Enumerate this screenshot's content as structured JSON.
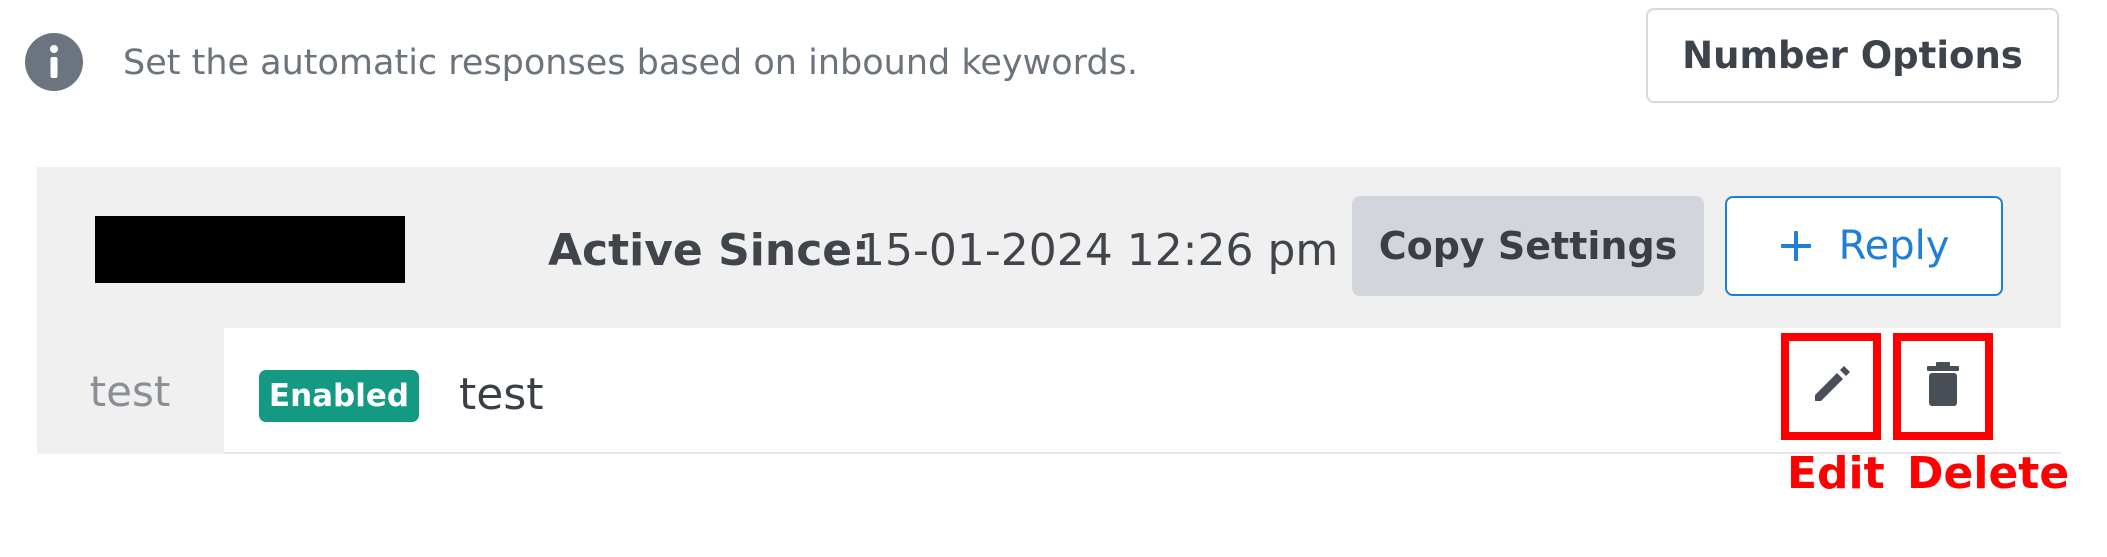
{
  "info": {
    "icon": "info-icon",
    "text": "Set the automatic responses based on inbound keywords."
  },
  "header_actions": {
    "number_options_label": "Number Options"
  },
  "keyword_panel": {
    "active_since_label": "Active Since:",
    "active_since_value": "15-01-2024 12:26 pm",
    "copy_settings_label": "Copy Settings",
    "reply_icon": "plus-icon",
    "reply_label": "Reply"
  },
  "keyword_row": {
    "keyword": "test",
    "status_badge": "Enabled",
    "response": "test",
    "edit_icon": "pencil-icon",
    "delete_icon": "trash-icon"
  },
  "annotations": {
    "edit_label": "Edit",
    "delete_label": "Delete",
    "color": "#ff0000"
  },
  "colors": {
    "accent_blue": "#1f7fd6",
    "badge_green": "#149a82",
    "panel_gray": "#f0f0f0"
  }
}
